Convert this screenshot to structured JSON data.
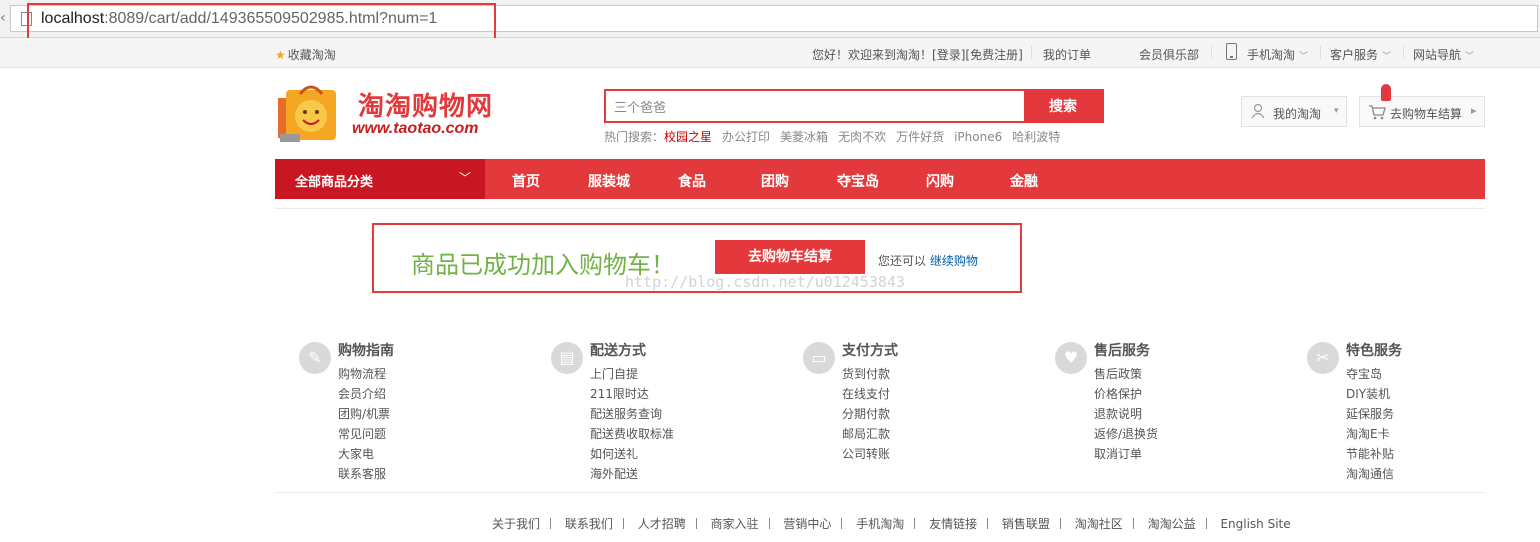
{
  "browser": {
    "url_host": "localhost",
    "url_rest": ":8089/cart/add/149365509502985.html?num=1"
  },
  "topbar": {
    "favorite": "收藏淘淘",
    "greeting": "您好！欢迎来到淘淘！",
    "login": "[登录]",
    "register": "[免费注册]",
    "my_orders": "我的订单",
    "vip_club": "会员俱乐部",
    "mobile": "手机淘淘",
    "customer_service": "客户服务",
    "site_nav": "网站导航"
  },
  "logo": {
    "cn": "淘淘购物网",
    "en": "www.taotao.com"
  },
  "search": {
    "value": "三个爸爸",
    "button": "搜索",
    "hot_label": "热门搜索：",
    "hot_items": [
      "校园之星",
      "办公打印",
      "美菱冰箱",
      "无肉不欢",
      "万件好货",
      "iPhone6",
      "哈利波特"
    ]
  },
  "user": {
    "my_taotao": "我的淘淘",
    "cart_checkout": "去购物车结算"
  },
  "category": {
    "all": "全部商品分类",
    "nav": [
      "首页",
      "服装城",
      "食品",
      "团购",
      "夺宝岛",
      "闪购",
      "金融"
    ]
  },
  "success": {
    "message": "商品已成功加入购物车！",
    "checkout_button": "去购物车结算",
    "also_text": "您还可以",
    "continue_link": "继续购物"
  },
  "watermark": "http://blog.csdn.net/u012453843",
  "footer": {
    "columns": [
      {
        "title": "购物指南",
        "icon": "compass-icon",
        "items": [
          "购物流程",
          "会员介绍",
          "团购/机票",
          "常见问题",
          "大家电",
          "联系客服"
        ]
      },
      {
        "title": "配送方式",
        "icon": "truck-icon",
        "items": [
          "上门自提",
          "211限时达",
          "配送服务查询",
          "配送费收取标准",
          "如何送礼",
          "海外配送"
        ]
      },
      {
        "title": "支付方式",
        "icon": "wallet-icon",
        "items": [
          "货到付款",
          "在线支付",
          "分期付款",
          "邮局汇款",
          "公司转账"
        ]
      },
      {
        "title": "售后服务",
        "icon": "heart-icon",
        "items": [
          "售后政策",
          "价格保护",
          "退款说明",
          "返修/退换货",
          "取消订单"
        ]
      },
      {
        "title": "特色服务",
        "icon": "wrench-icon",
        "items": [
          "夺宝岛",
          "DIY装机",
          "延保服务",
          "淘淘E卡",
          "节能补贴",
          "淘淘通信"
        ]
      }
    ],
    "links": [
      "关于我们",
      "联系我们",
      "人才招聘",
      "商家入驻",
      "营销中心",
      "手机淘淘",
      "友情链接",
      "销售联盟",
      "淘淘社区",
      "淘淘公益",
      "English Site"
    ]
  },
  "colors": {
    "brand_red": "#e4393c",
    "dark_red": "#c81623",
    "success_green": "#71b247",
    "link_blue": "#005ea7",
    "annotation_red": "#e43c3c"
  }
}
